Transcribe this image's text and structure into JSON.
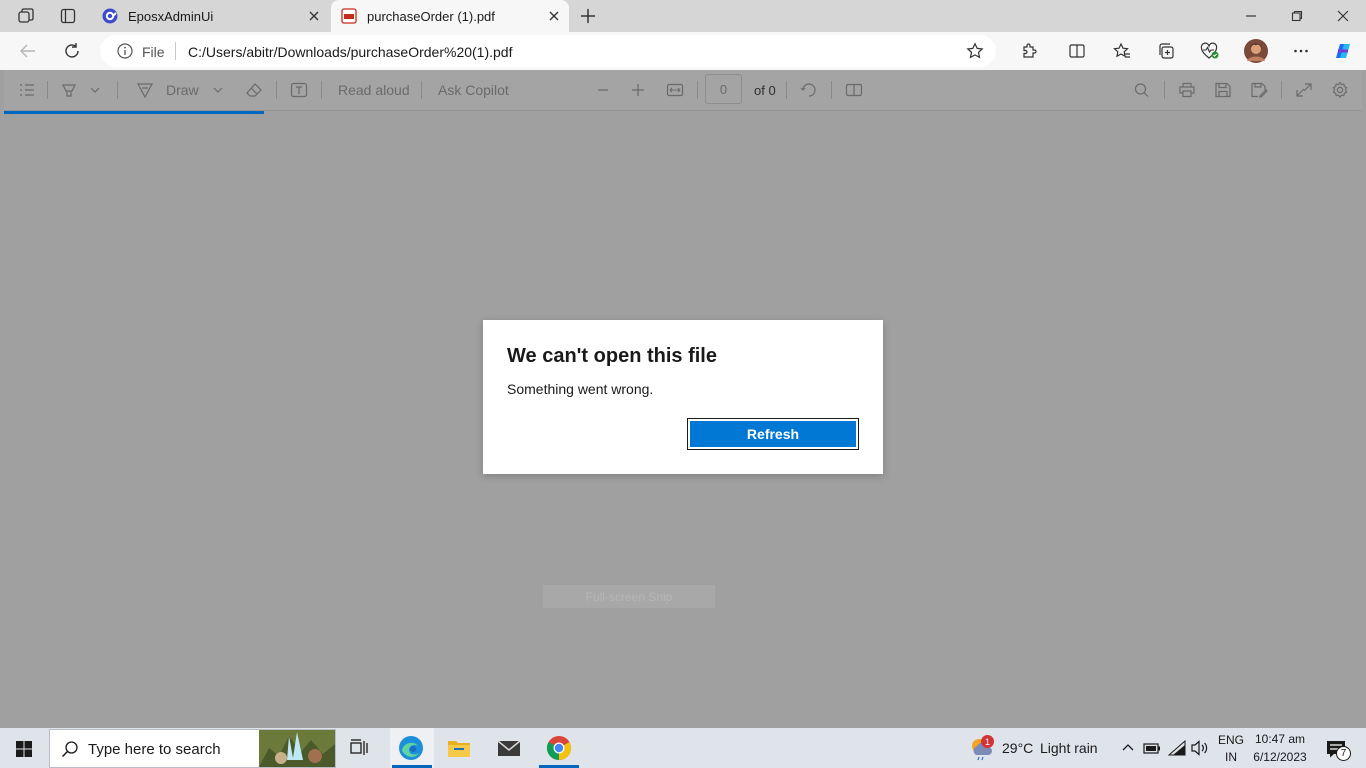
{
  "tabs": [
    {
      "title": "EposxAdminUi",
      "active": false
    },
    {
      "title": "purchaseOrder (1).pdf",
      "active": true
    }
  ],
  "address": {
    "scheme_label": "File",
    "url": "C:/Users/abitr/Downloads/purchaseOrder%20(1).pdf"
  },
  "pdf_toolbar": {
    "draw_label": "Draw",
    "read_aloud_label": "Read aloud",
    "ask_copilot_label": "Ask Copilot",
    "page_number": "0",
    "page_total": "of 0"
  },
  "dialog": {
    "title": "We can't open this file",
    "message": "Something went wrong.",
    "button_label": "Refresh"
  },
  "snip_label": "Full-screen Snip",
  "taskbar": {
    "search_placeholder": "Type here to search",
    "weather_temp": "29°C",
    "weather_desc": "Light rain",
    "weather_badge": "1",
    "lang_line1": "ENG",
    "lang_line2": "IN",
    "time": "10:47 am",
    "date": "6/12/2023",
    "notification_count": "7"
  },
  "colors": {
    "accent": "#0067c0",
    "button": "#0078d4",
    "overlay": "#a0a0a0"
  }
}
